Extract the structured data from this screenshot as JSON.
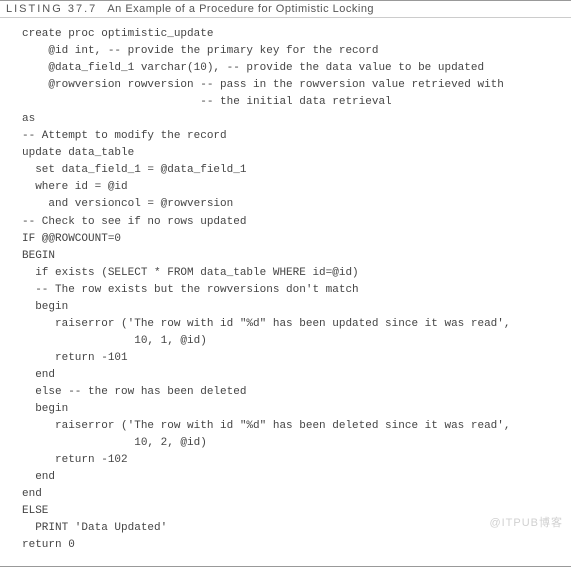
{
  "header": {
    "listing_no": "LISTING 37.7",
    "title": "An Example of a Procedure for Optimistic Locking"
  },
  "code": {
    "lines": [
      "create proc optimistic_update",
      "    @id int, -- provide the primary key for the record",
      "    @data_field_1 varchar(10), -- provide the data value to be updated",
      "    @rowversion rowversion -- pass in the rowversion value retrieved with",
      "                           -- the initial data retrieval",
      "as",
      "-- Attempt to modify the record",
      "update data_table",
      "  set data_field_1 = @data_field_1",
      "  where id = @id",
      "    and versioncol = @rowversion",
      "-- Check to see if no rows updated",
      "IF @@ROWCOUNT=0",
      "BEGIN",
      "  if exists (SELECT * FROM data_table WHERE id=@id)",
      "  -- The row exists but the rowversions don't match",
      "  begin",
      "     raiserror ('The row with id \"%d\" has been updated since it was read',",
      "                 10, 1, @id)",
      "     return -101",
      "  end",
      "  else -- the row has been deleted",
      "  begin",
      "     raiserror ('The row with id \"%d\" has been deleted since it was read',",
      "                 10, 2, @id)",
      "     return -102",
      "  end",
      "end",
      "ELSE",
      "  PRINT 'Data Updated'",
      "return 0"
    ]
  },
  "watermark": "@ITPUB博客"
}
